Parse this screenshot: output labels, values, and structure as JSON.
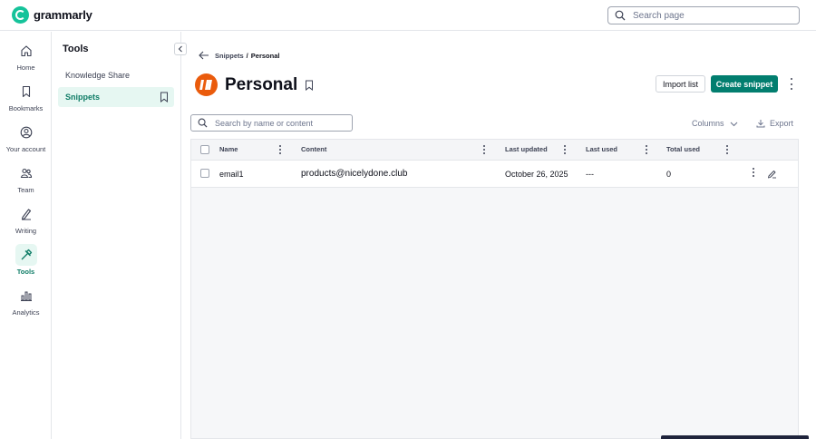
{
  "app": {
    "brand": "grammarly"
  },
  "topbar": {
    "search_placeholder": "Search page"
  },
  "rail": {
    "items": [
      {
        "label": "Home",
        "icon": "home-icon"
      },
      {
        "label": "Bookmarks",
        "icon": "bookmark-icon"
      },
      {
        "label": "Your account",
        "icon": "account-icon"
      },
      {
        "label": "Team",
        "icon": "team-icon"
      },
      {
        "label": "Writing",
        "icon": "pen-icon"
      },
      {
        "label": "Tools",
        "icon": "tools-icon",
        "active": true
      },
      {
        "label": "Analytics",
        "icon": "analytics-icon"
      }
    ]
  },
  "subnav": {
    "title": "Tools",
    "items": [
      {
        "label": "Knowledge Share"
      },
      {
        "label": "Snippets",
        "active": true
      }
    ]
  },
  "breadcrumb": {
    "parent": "Snippets",
    "separator": "/",
    "current": "Personal"
  },
  "page": {
    "title": "Personal"
  },
  "actions": {
    "import_label": "Import list",
    "create_label": "Create snippet"
  },
  "search": {
    "placeholder": "Search by name or content"
  },
  "toolbar": {
    "columns_label": "Columns",
    "export_label": "Export"
  },
  "table": {
    "columns": [
      "Name",
      "Content",
      "Last updated",
      "Last used",
      "Total used"
    ],
    "rows": [
      {
        "name": "email1",
        "content": "products@nicelydone.club",
        "last_updated": "October 26, 2025",
        "last_used": "---",
        "total_used": "0"
      }
    ]
  },
  "colors": {
    "accent": "#027e6f",
    "brand": "#15c39a",
    "avatar": "#ea5b0c",
    "active_bg": "#e6f7f2"
  }
}
